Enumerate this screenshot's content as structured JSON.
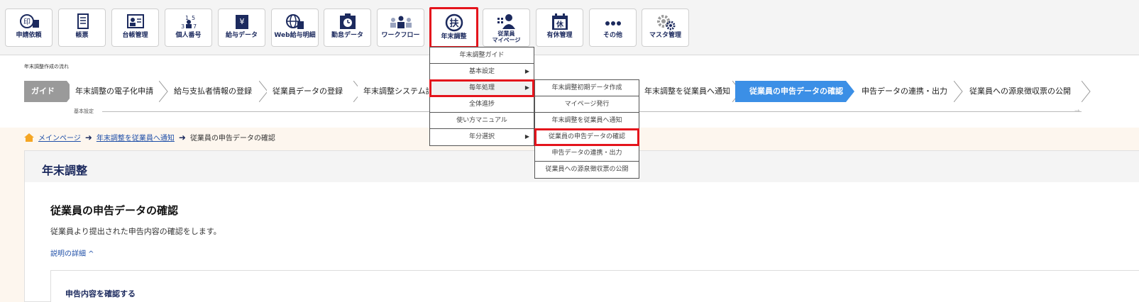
{
  "toolbar": {
    "buttons": [
      {
        "label": "申請依頼",
        "icon": "stamp-icon"
      },
      {
        "label": "帳票",
        "icon": "document-icon"
      },
      {
        "label": "台帳管理",
        "icon": "ledger-icon"
      },
      {
        "label": "個人番号",
        "icon": "number-icon"
      },
      {
        "label": "給与データ",
        "icon": "salary-data-icon"
      },
      {
        "label": "Web給与明細",
        "icon": "web-payslip-icon"
      },
      {
        "label": "勤怠データ",
        "icon": "attendance-icon"
      },
      {
        "label": "ワークフロー",
        "icon": "workflow-icon"
      },
      {
        "label": "年末調整",
        "icon": "fuyo-icon"
      },
      {
        "label": "従業員",
        "label2": "マイページ",
        "icon": "employee-mypage-icon"
      },
      {
        "label": "有休管理",
        "icon": "paid-leave-icon"
      },
      {
        "label": "その他",
        "icon": "more-icon"
      },
      {
        "label": "マスタ管理",
        "icon": "gear-icon"
      }
    ],
    "number_icon_digits": [
      "1",
      "5",
      "3",
      "7"
    ],
    "fuyo_glyph": "扶",
    "leave_glyph": "休"
  },
  "flow": {
    "caption": "年末調整作成の流れ",
    "steps": [
      "ガイド",
      "年末調整の電子化申請",
      "給与支払者情報の登録",
      "従業員データの登録",
      "年末調整システム設",
      "年末調整を従業員へ通知",
      "従業員の申告データの確認",
      "申告データの連携・出力",
      "従業員への源泉徴収票の公開"
    ],
    "sub_label": "基本設定"
  },
  "breadcrumb": {
    "home": "メインページ",
    "parent": "年末調整を従業員へ通知",
    "current": "従業員の申告データの確認"
  },
  "main": {
    "title": "年末調整",
    "section_title": "従業員の申告データの確認",
    "section_desc": "従業員より提出された申告内容の確認をします。",
    "detail_link": "説明の詳細 ^",
    "inner_title": "申告内容を確認する"
  },
  "menu": {
    "items": [
      {
        "label": "年末調整ガイド",
        "has_sub": false
      },
      {
        "label": "基本設定",
        "has_sub": true
      },
      {
        "label": "毎年処理",
        "has_sub": true
      },
      {
        "label": "全体進捗",
        "has_sub": false
      },
      {
        "label": "使い方マニュアル",
        "has_sub": false
      },
      {
        "label": "年分選択",
        "has_sub": true
      }
    ],
    "sub_arrow": "▶"
  },
  "submenu": {
    "items": [
      "年末調整初期データ作成",
      "マイページ発行",
      "年末調整を従業員へ通知",
      "従業員の申告データの確認",
      "申告データの連携・出力",
      "従業員への源泉徴収票の公開"
    ]
  },
  "colors": {
    "navy": "#1c2a5e",
    "highlight_red": "#e4141c",
    "current_step_blue": "#3b8fe6",
    "guide_gray": "#9a9a9a",
    "home_icon_orange": "#f5a623"
  }
}
